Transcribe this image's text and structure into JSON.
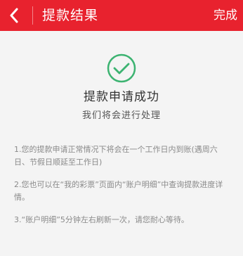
{
  "header": {
    "back_icon": "chevron-left-icon",
    "title": "提款结果",
    "done_label": "完成",
    "bg_color": "#e8222e"
  },
  "result": {
    "icon": "check-circle-icon",
    "icon_color": "#3cb371",
    "title": "提款申请成功",
    "subtitle": "我们将会进行处理"
  },
  "notes": [
    "1.您的提款申请正常情况下将会在一个工作日内到账(遇周六日、节假日顺延至工作日)",
    "2.您也可以在“我的彩票”页面内“账户明细”中查询提款进度详情。",
    "3.“账户明细”5分钟左右刷新一次，请您耐心等待。"
  ]
}
